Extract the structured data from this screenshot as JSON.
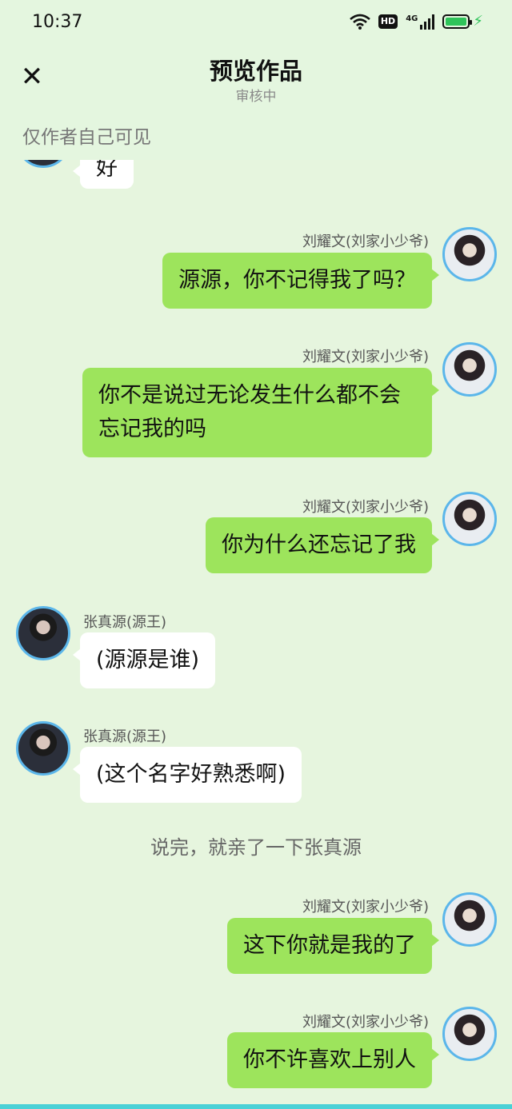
{
  "status": {
    "time": "10:37",
    "hd": "HD",
    "network": "4G"
  },
  "header": {
    "title": "预览作品",
    "subtitle": "审核中",
    "visibility": "仅作者自己可见"
  },
  "icons": {
    "close": "close-icon",
    "wifi": "wifi-icon",
    "battery": "battery-icon"
  },
  "colors": {
    "right_bubble": "#9de45c",
    "left_bubble": "#ffffff",
    "avatar_ring": "#5bb6ea",
    "background": "#e6f5de"
  },
  "messages": [
    {
      "side": "left",
      "text": "好"
    },
    {
      "side": "right",
      "name": "刘耀文(刘家小少爷)",
      "text": "源源，你不记得我了吗？"
    },
    {
      "side": "right",
      "name": "刘耀文(刘家小少爷)",
      "text": "你不是说过无论发生什么都不会忘记我的吗"
    },
    {
      "side": "right",
      "name": "刘耀文(刘家小少爷)",
      "text": "你为什么还忘记了我"
    },
    {
      "side": "left",
      "name": "张真源(源王)",
      "text": "(源源是谁)"
    },
    {
      "side": "left",
      "name": "张真源(源王)",
      "text": "(这个名字好熟悉啊)"
    },
    {
      "side": "right",
      "name": "刘耀文(刘家小少爷)",
      "text": "这下你就是我的了"
    },
    {
      "side": "right",
      "name": "刘耀文(刘家小少爷)",
      "text": "你不许喜欢上别人"
    }
  ],
  "narration": "说完，就亲了一下张真源"
}
